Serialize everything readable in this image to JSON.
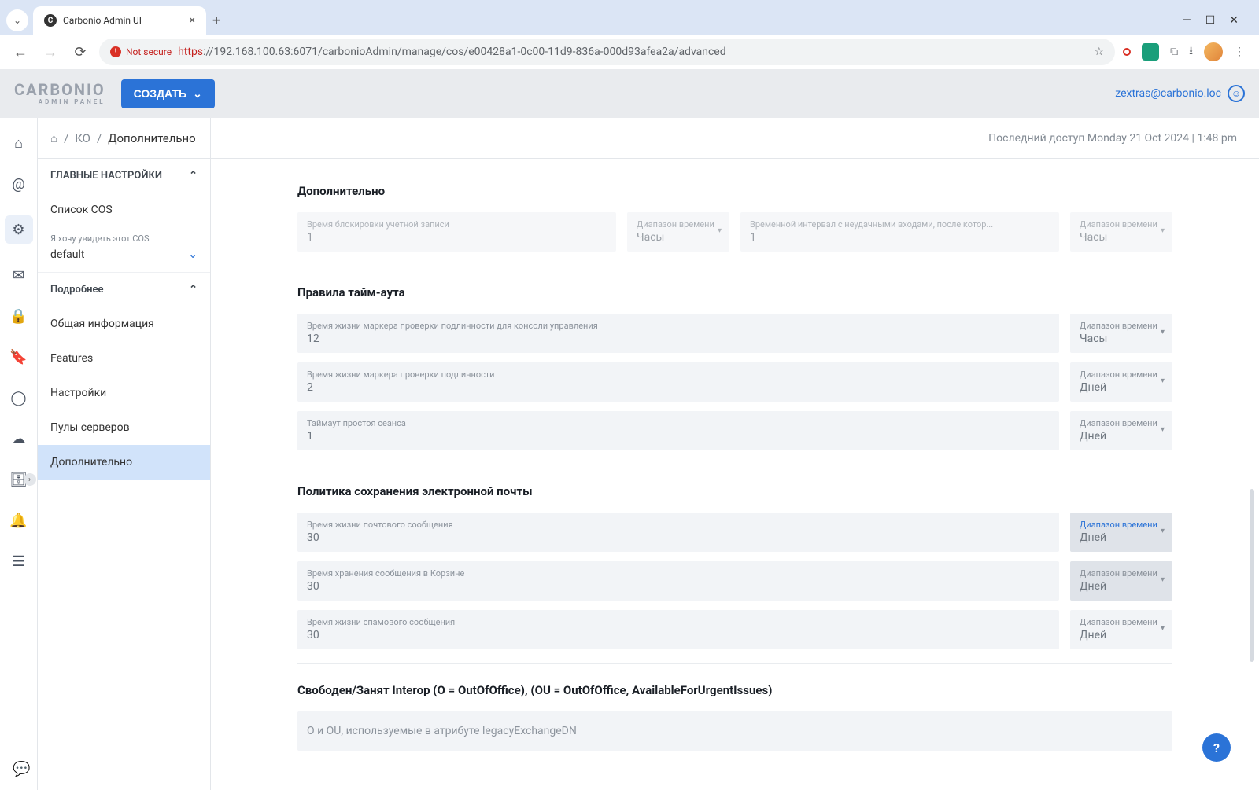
{
  "browser": {
    "tab_title": "Carbonio Admin UI",
    "insecure_label": "Not secure",
    "url_proto": "https",
    "url_rest": "://192.168.100.63:6071/carbonioAdmin/manage/cos/e00428a1-0c00-11d9-836a-000d93afea2a/advanced"
  },
  "header": {
    "logo_main": "CARBONIO",
    "logo_sub": "ADMIN PANEL",
    "create_button": "СОЗДАТЬ",
    "user_email": "zextras@carbonio.loc"
  },
  "breadcrumb": {
    "seg1": "КО",
    "seg2": "Дополнительно"
  },
  "last_access": "Последний доступ Monday 21 Oct 2024 | 1:48 pm",
  "sidebar": {
    "section_main": "ГЛАВНЫЕ НАСТРОЙКИ",
    "item_cos_list": "Список COS",
    "cos_selector_label": "Я хочу увидеть этот COS",
    "cos_selector_value": "default",
    "section_details": "Подробнее",
    "items": {
      "general": "Общая информация",
      "features": "Features",
      "settings": "Настройки",
      "pools": "Пулы серверов",
      "advanced": "Дополнительно"
    }
  },
  "content": {
    "sec1_title": "Дополнительно",
    "sec1": {
      "lockout_label": "Время блокировки учетной записи",
      "lockout_value": "1",
      "lockout_unit_label": "Диапазон времени",
      "lockout_unit_value": "Часы",
      "interval_label": "Временной интервал с неудачными входами, после котор...",
      "interval_value": "1",
      "interval_unit_label": "Диапазон времени",
      "interval_unit_value": "Часы"
    },
    "sec2_title": "Правила тайм-аута",
    "sec2": {
      "console_label": "Время жизни маркера проверки подлинности для консоли управления",
      "console_value": "12",
      "console_unit_label": "Диапазон времени",
      "console_unit_value": "Часы",
      "auth_label": "Время жизни маркера проверки подлинности",
      "auth_value": "2",
      "auth_unit_label": "Диапазон времени",
      "auth_unit_value": "Дней",
      "idle_label": "Таймаут простоя сеанса",
      "idle_value": "1",
      "idle_unit_label": "Диапазон времени",
      "idle_unit_value": "Дней"
    },
    "sec3_title": "Политика сохранения электронной почты",
    "sec3": {
      "msg_life_label": "Время жизни почтового сообщения",
      "msg_life_value": "30",
      "msg_life_unit_label": "Диапазон времени",
      "msg_life_unit_value": "Дней",
      "trash_label": "Время хранения сообщения в Корзине",
      "trash_value": "30",
      "trash_unit_label": "Диапазон времени",
      "trash_unit_value": "Дней",
      "spam_label": "Время жизни спамового сообщения",
      "spam_value": "30",
      "spam_unit_label": "Диапазон времени",
      "spam_unit_value": "Дней"
    },
    "sec4_title": "Свободен/Занят Interop (O = OutOfOffice), (OU = OutOfOffice, AvailableForUrgentIssues)",
    "sec4": {
      "legacy_label": "O и OU, используемые в атрибуте legacyExchangeDN"
    }
  }
}
